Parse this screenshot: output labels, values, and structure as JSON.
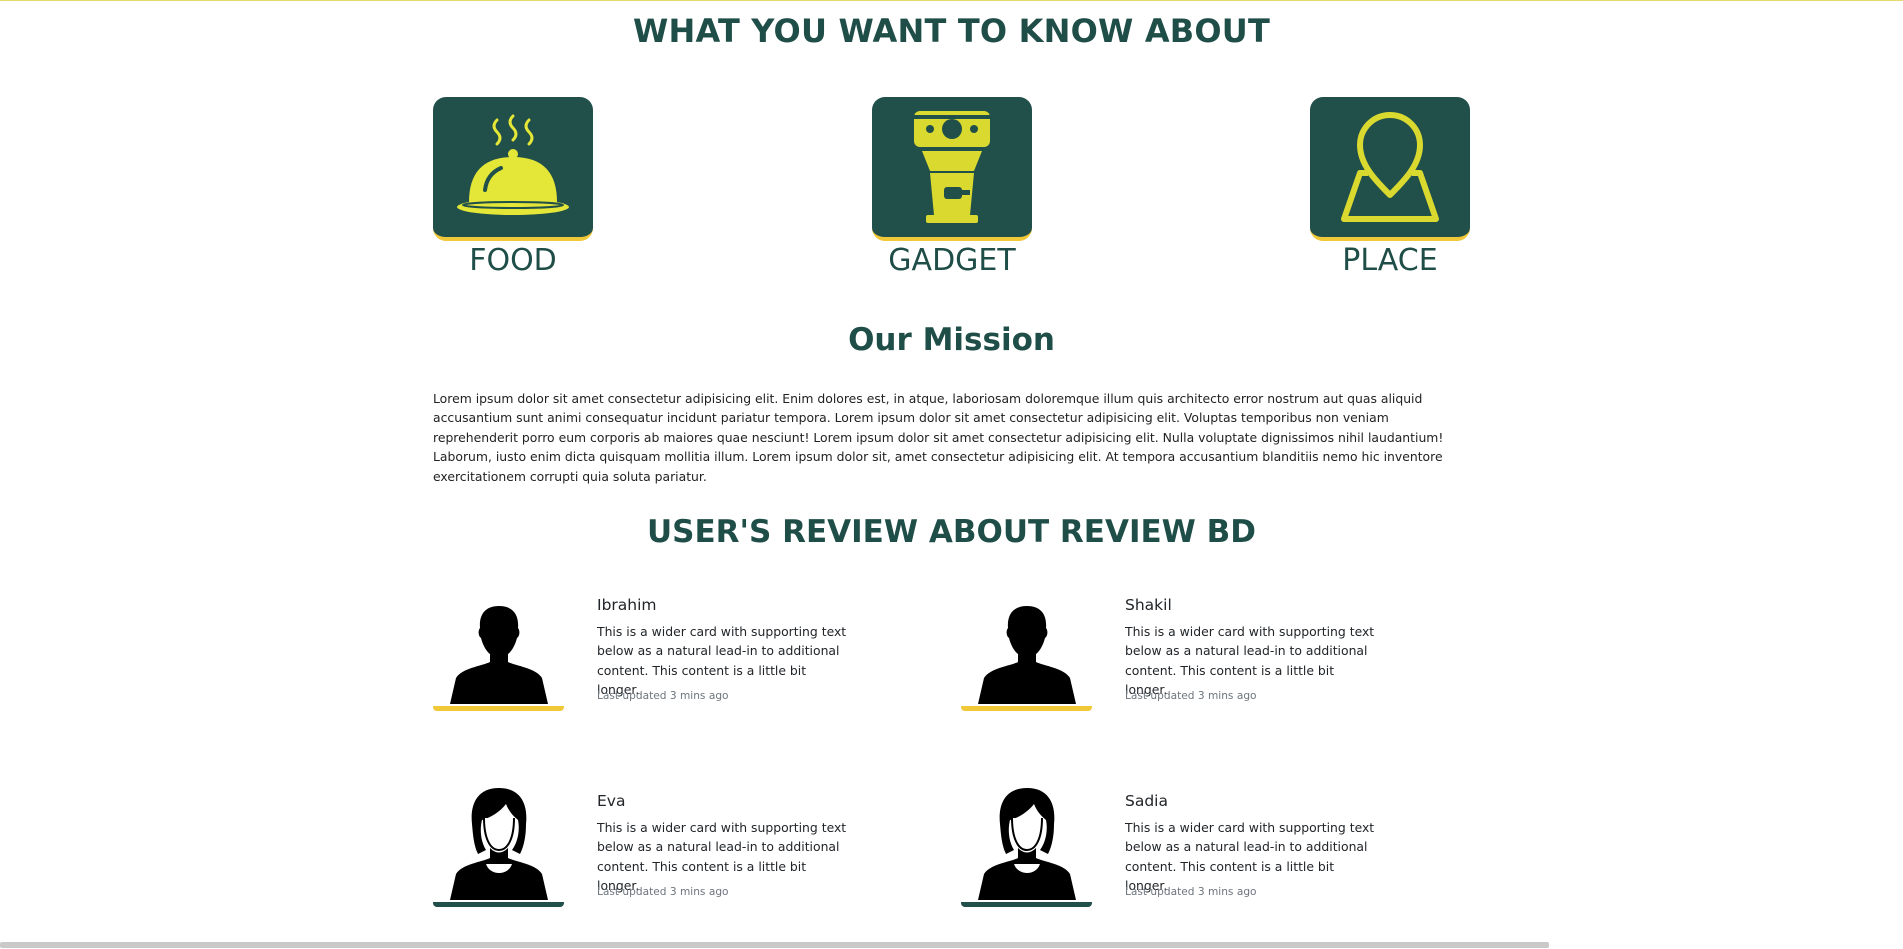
{
  "know": {
    "title": "WHAT YOU WANT TO KNOW ABOUT",
    "categories": [
      {
        "label": "FOOD",
        "icon": "food-cloche-icon"
      },
      {
        "label": "GADGET",
        "icon": "gadget-machine-icon"
      },
      {
        "label": "PLACE",
        "icon": "place-pin-icon"
      }
    ]
  },
  "mission": {
    "title": "Our Mission",
    "text": "Lorem ipsum dolor sit amet consectetur adipisicing elit. Enim dolores est, in atque, laboriosam doloremque illum quis architecto error nostrum aut quas aliquid accusantium sunt animi consequatur incidunt pariatur tempora. Lorem ipsum dolor sit amet consectetur adipisicing elit. Voluptas temporibus non veniam reprehenderit porro eum corporis ab maiores quae nesciunt! Lorem ipsum dolor sit amet consectetur adipisicing elit. Nulla voluptate dignissimos nihil laudantium! Laborum, iusto enim dicta quisquam mollitia illum. Lorem ipsum dolor sit, amet consectetur adipisicing elit. At tempora accusantium blanditiis nemo hic inventore exercitationem corrupti quia soluta pariatur."
  },
  "reviews": {
    "title": "USER'S REVIEW ABOUT REVIEW BD",
    "items": [
      {
        "name": "Ibrahim",
        "text": "This is a wider card with supporting text below as a natural lead-in to additional content. This content is a little bit longer.",
        "updated": "Last updated 3 mins ago"
      },
      {
        "name": "Shakil",
        "text": "This is a wider card with supporting text below as a natural lead-in to additional content. This content is a little bit longer.",
        "updated": "Last updated 3 mins ago"
      },
      {
        "name": "Eva",
        "text": "This is a wider card with supporting text below as a natural lead-in to additional content. This content is a little bit longer.",
        "updated": "Last updated 3 mins ago"
      },
      {
        "name": "Sadia",
        "text": "This is a wider card with supporting text below as a natural lead-in to additional content. This content is a little bit longer.",
        "updated": "Last updated 3 mins ago"
      }
    ]
  },
  "colors": {
    "primary": "#21504a",
    "accent": "#f0c838",
    "icon": "#e4e638"
  }
}
